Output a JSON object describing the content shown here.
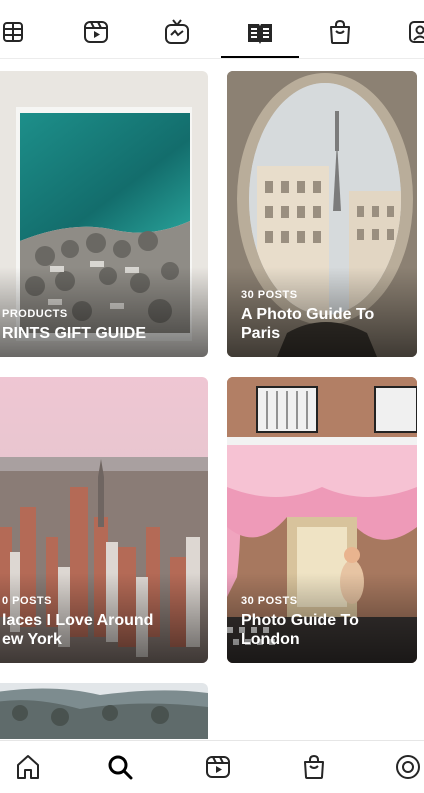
{
  "tabs": [
    {
      "name": "grid-tab",
      "icon": "list-icon"
    },
    {
      "name": "reels-tab",
      "icon": "reels-icon"
    },
    {
      "name": "igtv-tab",
      "icon": "tv-icon"
    },
    {
      "name": "guides-tab",
      "icon": "guide-book-icon",
      "active": true
    },
    {
      "name": "shop-tab",
      "icon": "shopping-bag-icon"
    },
    {
      "name": "tagged-tab",
      "icon": "tagged-icon"
    }
  ],
  "guides": [
    {
      "count": "PRODUCTS",
      "title": "RINTS GIFT GUIDE"
    },
    {
      "count": "30 POSTS",
      "title": "A Photo Guide To Paris"
    },
    {
      "count": "0 POSTS",
      "title": "laces I Love Around ew York"
    },
    {
      "count": "30 POSTS",
      "title": "Photo Guide To London"
    }
  ],
  "bottom_nav": [
    {
      "name": "home",
      "icon": "home-icon"
    },
    {
      "name": "search",
      "icon": "search-icon",
      "active": true
    },
    {
      "name": "reels",
      "icon": "reels-icon"
    },
    {
      "name": "shop",
      "icon": "shopping-bag-icon"
    },
    {
      "name": "profile",
      "icon": "profile-icon"
    }
  ]
}
